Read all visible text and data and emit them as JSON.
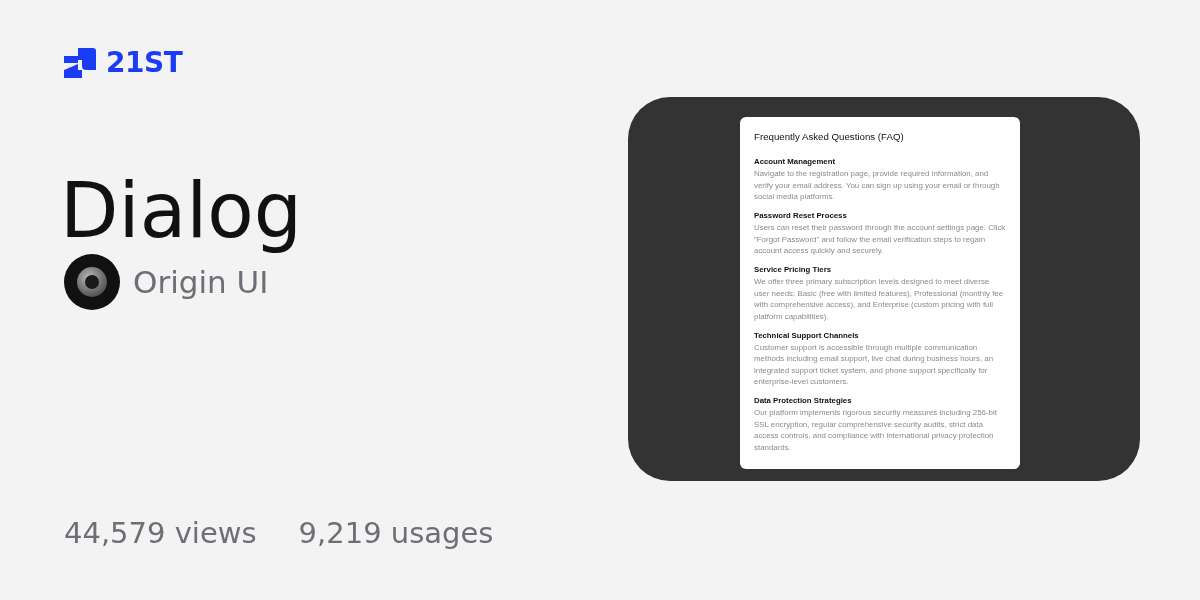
{
  "brand": {
    "name": "21ST"
  },
  "component": {
    "title": "Dialog",
    "author": "Origin UI"
  },
  "stats": [
    "44,579 views",
    "9,219 usages"
  ],
  "preview": {
    "dialog": {
      "title": "Frequently Asked Questions (FAQ)",
      "sections": [
        {
          "heading": "Account Management",
          "body": "Navigate to the registration page, provide required information, and verify your email address. You can sign up using your email or through social media platforms."
        },
        {
          "heading": "Password Reset Process",
          "body": "Users can reset their password through the account settings page. Click \"Forgot Password\" and follow the email verification steps to regain account access quickly and securely."
        },
        {
          "heading": "Service Pricing Tiers",
          "body": "We offer three primary subscription levels designed to meet diverse user needs: Basic (free with limited features), Professional (monthly fee with comprehensive access), and Enterprise (custom pricing with full platform capabilities)."
        },
        {
          "heading": "Technical Support Channels",
          "body": "Customer support is accessible through multiple communication methods including email support, live chat during business hours, an integrated support ticket system, and phone support specifically for enterprise-level customers."
        },
        {
          "heading": "Data Protection Strategies",
          "body": "Our platform implements rigorous security measures including 256-bit SSL encryption, regular comprehensive security audits, strict data access controls, and compliance with international privacy protection standards."
        }
      ]
    }
  }
}
